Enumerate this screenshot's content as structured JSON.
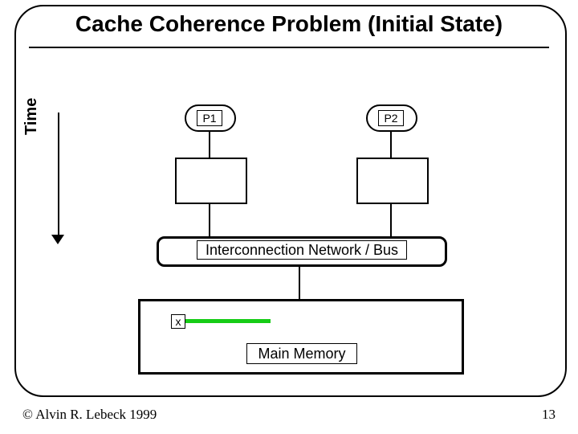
{
  "title": "Cache Coherence Problem (Initial State)",
  "time_label": "Time",
  "processors": {
    "p1": "P1",
    "p2": "P2"
  },
  "bus_label": "Interconnection Network / Bus",
  "memory": {
    "var": "x",
    "label": "Main Memory"
  },
  "footer": {
    "copyright": "© Alvin R. Lebeck 1999",
    "page": "13"
  }
}
